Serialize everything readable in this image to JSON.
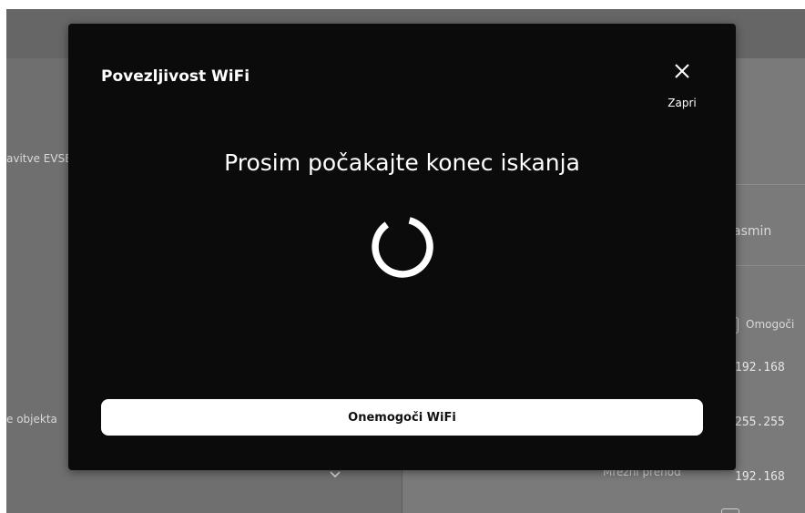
{
  "background": {
    "left_labels": [
      "avitve EVSE",
      "e objekta"
    ],
    "right_name": "asmin",
    "right_checkbox_label": "Omogoči",
    "ip_values": [
      "192.168",
      "255.255",
      "192.168"
    ],
    "gateway_label": "Mrežni prehod"
  },
  "modal": {
    "title": "Povezljivost WiFi",
    "close_label": "Zapri",
    "message": "Prosim počakajte konec iskanja",
    "disable_button": "Onemogoči WiFi"
  }
}
